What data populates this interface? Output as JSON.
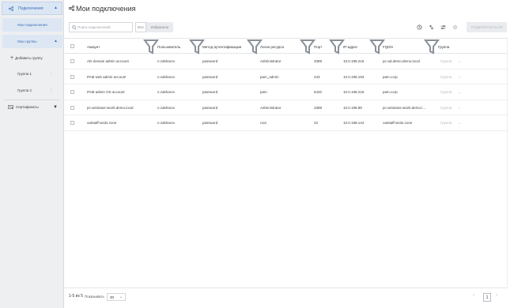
{
  "sidebar": {
    "connections": {
      "label": "Подключения"
    },
    "my_connections": {
      "label": "Мои подключения"
    },
    "my_groups": {
      "label": "Мои группы"
    },
    "add_group": {
      "label": "Добавить группу"
    },
    "groups": [
      {
        "label": "Группа 1"
      },
      {
        "label": "Группа 2"
      }
    ],
    "certificates": {
      "label": "Сертификаты"
    }
  },
  "header": {
    "title": "Мои подключения"
  },
  "toolbar": {
    "search_placeholder": "Поиск подключений",
    "filter_all": "Все",
    "filter_favorites": "Избранное",
    "connect_label": "ПОДКЛЮЧИТЬСЯ"
  },
  "table": {
    "columns": [
      "Аккаунт",
      "Пользователь",
      "Метод аутентификации",
      "Логин ресурса",
      "Порт",
      "IP-адрес",
      "FQDN",
      "Группа"
    ],
    "rows": [
      {
        "account": "AD domain admin account",
        "user": "n.zakharov",
        "auth": "password",
        "login": "Administrator",
        "port": "3389",
        "ip": "10.0.198.216",
        "fqdn": "pc-ad.demo.demo.local",
        "group": "Группа"
      },
      {
        "account": "PAM web admin account",
        "user": "n.zakharov",
        "auth": "password",
        "login": "pam_admin",
        "port": "443",
        "ip": "10.0.198.193",
        "fqdn": "pam.corp",
        "group": "Группа"
      },
      {
        "account": "PAM admin OS account",
        "user": "n.zakharov",
        "auth": "password",
        "login": "pam",
        "port": "5432",
        "ip": "10.0.198.216",
        "fqdn": "pam.corp",
        "group": "Группа"
      },
      {
        "account": "pc-windows-ws20.demo.local",
        "user": "n.zakharov",
        "auth": "password",
        "login": "Administrator",
        "port": "3389",
        "ip": "10.0.198.99",
        "fqdn": "pc-windows-ws20.demo.l...",
        "group": "Группа"
      },
      {
        "account": "outstaff-ws3s.zone",
        "user": "n.zakharov",
        "auth": "password",
        "login": "root",
        "port": "22",
        "ip": "10.0.198.144",
        "fqdn": "outstaff-ws3s.zone",
        "group": "Группа"
      }
    ]
  },
  "pagination": {
    "range_text": "1-5 из 5",
    "show_label": "Показывать",
    "page_size": "30",
    "current_page": "1"
  },
  "colors": {
    "accent": "#3e6db5",
    "sidebar_bg": "#eeeff1",
    "active_bg": "#dde7f4"
  }
}
